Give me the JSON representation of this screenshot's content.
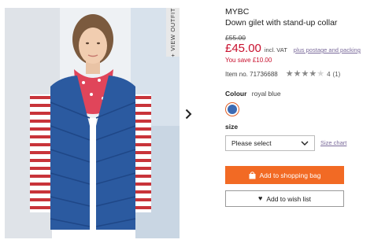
{
  "product": {
    "brand": "MYBC",
    "title": "Down gilet with stand-up collar",
    "old_price": "£55.00",
    "price": "£45.00",
    "vat": "incl. VAT",
    "postage_link": "plus postage and packing",
    "you_save": "You save £10.00",
    "item_no": "Item no. 71736688",
    "rating": {
      "value": 4,
      "out_of": 5,
      "score_text": "4",
      "count_text": "(1)"
    }
  },
  "gallery": {
    "view_outfit": "+ VIEW OUTFIT",
    "next_icon": "chevron-right-icon"
  },
  "colour": {
    "label": "Colour",
    "value": "royal blue",
    "swatch_color": "#3c6bb4",
    "selected_ring_color": "#e0602a"
  },
  "size": {
    "label": "size",
    "selected": "Please select",
    "chart_link": "Size chart"
  },
  "actions": {
    "add_to_bag": "Add to shopping bag",
    "add_to_bag_color": "#f26a24",
    "add_to_wishlist": "Add to wish list"
  },
  "colors": {
    "price_red": "#c8102e",
    "link_purple": "#7a6a9a"
  }
}
